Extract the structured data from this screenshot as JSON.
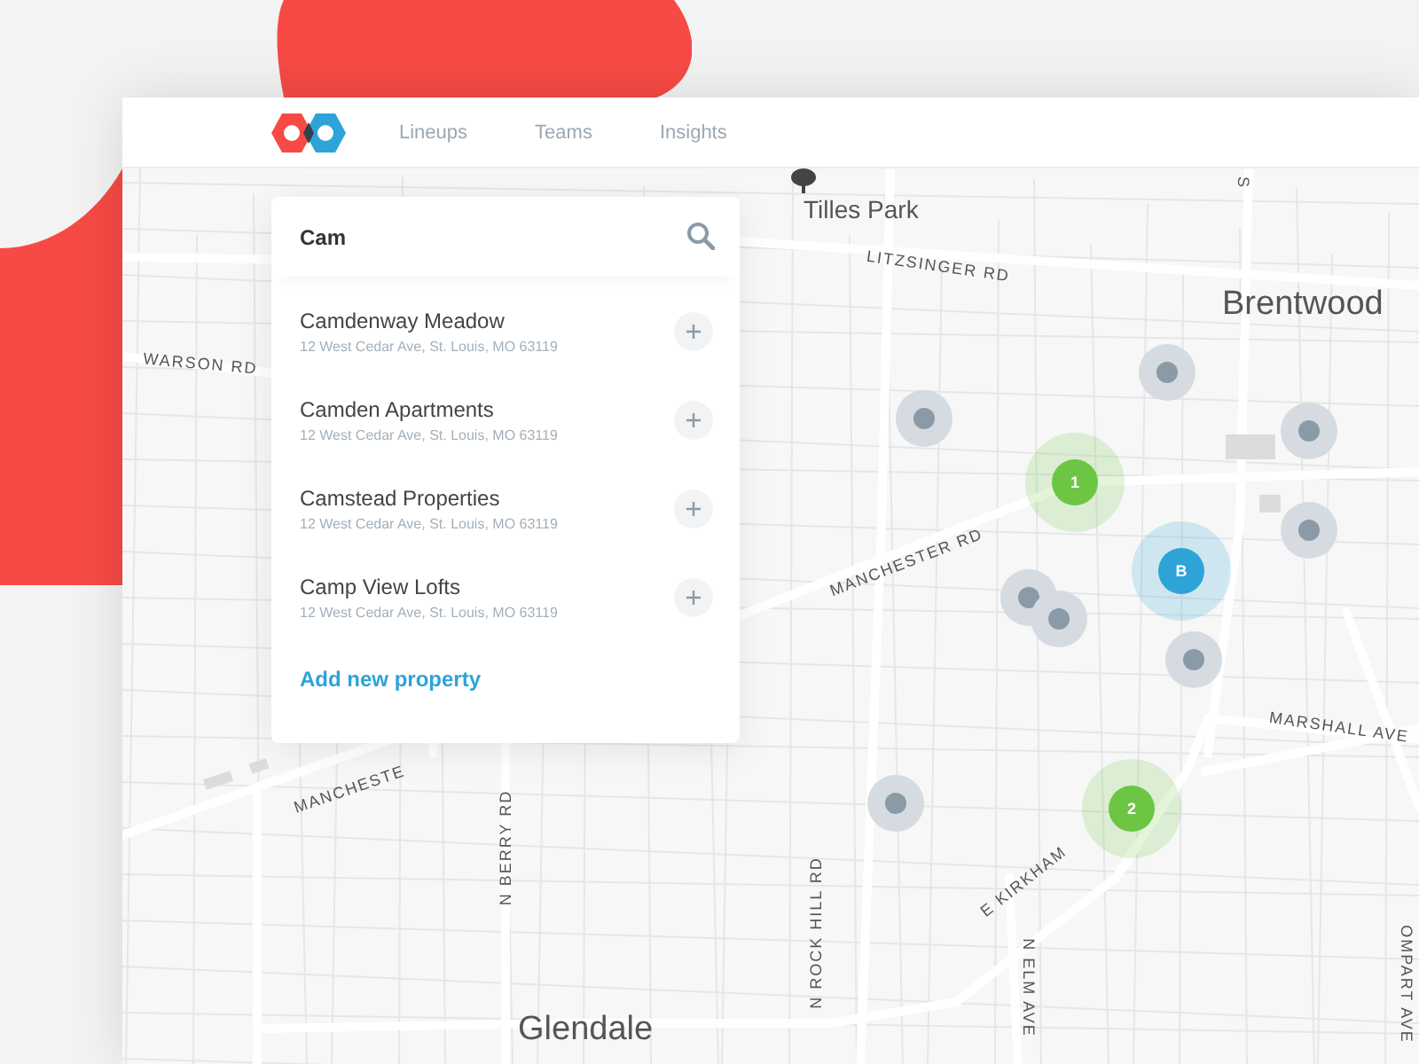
{
  "nav": {
    "links": [
      {
        "label": "Lineups"
      },
      {
        "label": "Teams"
      },
      {
        "label": "Insights"
      }
    ]
  },
  "search": {
    "value": "Cam"
  },
  "results": [
    {
      "name": "Camdenway Meadow",
      "address": "12 West Cedar Ave, St. Louis, MO 63119"
    },
    {
      "name": "Camden Apartments",
      "address": "12 West Cedar Ave, St. Louis, MO 63119"
    },
    {
      "name": "Camstead Properties",
      "address": "12 West Cedar Ave, St. Louis, MO 63119"
    },
    {
      "name": "Camp View Lofts",
      "address": "12 West Cedar Ave, St. Louis, MO 63119"
    }
  ],
  "add_link": "Add new property",
  "map": {
    "labels": [
      {
        "text": "Tilles Park",
        "kind": "park"
      },
      {
        "text": "LITZSINGER RD",
        "kind": "road"
      },
      {
        "text": "Brentwood",
        "kind": "place"
      },
      {
        "text": "WARSON RD",
        "kind": "road"
      },
      {
        "text": "MANCHESTER RD",
        "kind": "road"
      },
      {
        "text": "MANCHESTE",
        "kind": "road"
      },
      {
        "text": "N BERRY RD",
        "kind": "road"
      },
      {
        "text": "N ROCK HILL RD",
        "kind": "road"
      },
      {
        "text": "N ELM AVE",
        "kind": "road"
      },
      {
        "text": "E KIRKHAM",
        "kind": "road"
      },
      {
        "text": "MARSHALL AVE",
        "kind": "road"
      },
      {
        "text": "Glendale",
        "kind": "place"
      },
      {
        "text": "OMPART AVE",
        "kind": "road"
      },
      {
        "text": "S",
        "kind": "road"
      }
    ],
    "markers": [
      {
        "kind": "pin",
        "color": "#8a9aa6"
      },
      {
        "kind": "pin",
        "color": "#8a9aa6"
      },
      {
        "kind": "pin",
        "color": "#8a9aa6"
      },
      {
        "kind": "pin",
        "color": "#8a9aa6"
      },
      {
        "kind": "pin",
        "color": "#8a9aa6"
      },
      {
        "kind": "pin",
        "color": "#8a9aa6"
      },
      {
        "kind": "pin",
        "color": "#8a9aa6"
      },
      {
        "kind": "pin",
        "color": "#8a9aa6"
      },
      {
        "kind": "cluster",
        "label": "1",
        "color": "#6cc644"
      },
      {
        "kind": "cluster",
        "label": "B",
        "color": "#2ea3d8"
      },
      {
        "kind": "cluster",
        "label": "2",
        "color": "#6cc644"
      }
    ]
  }
}
